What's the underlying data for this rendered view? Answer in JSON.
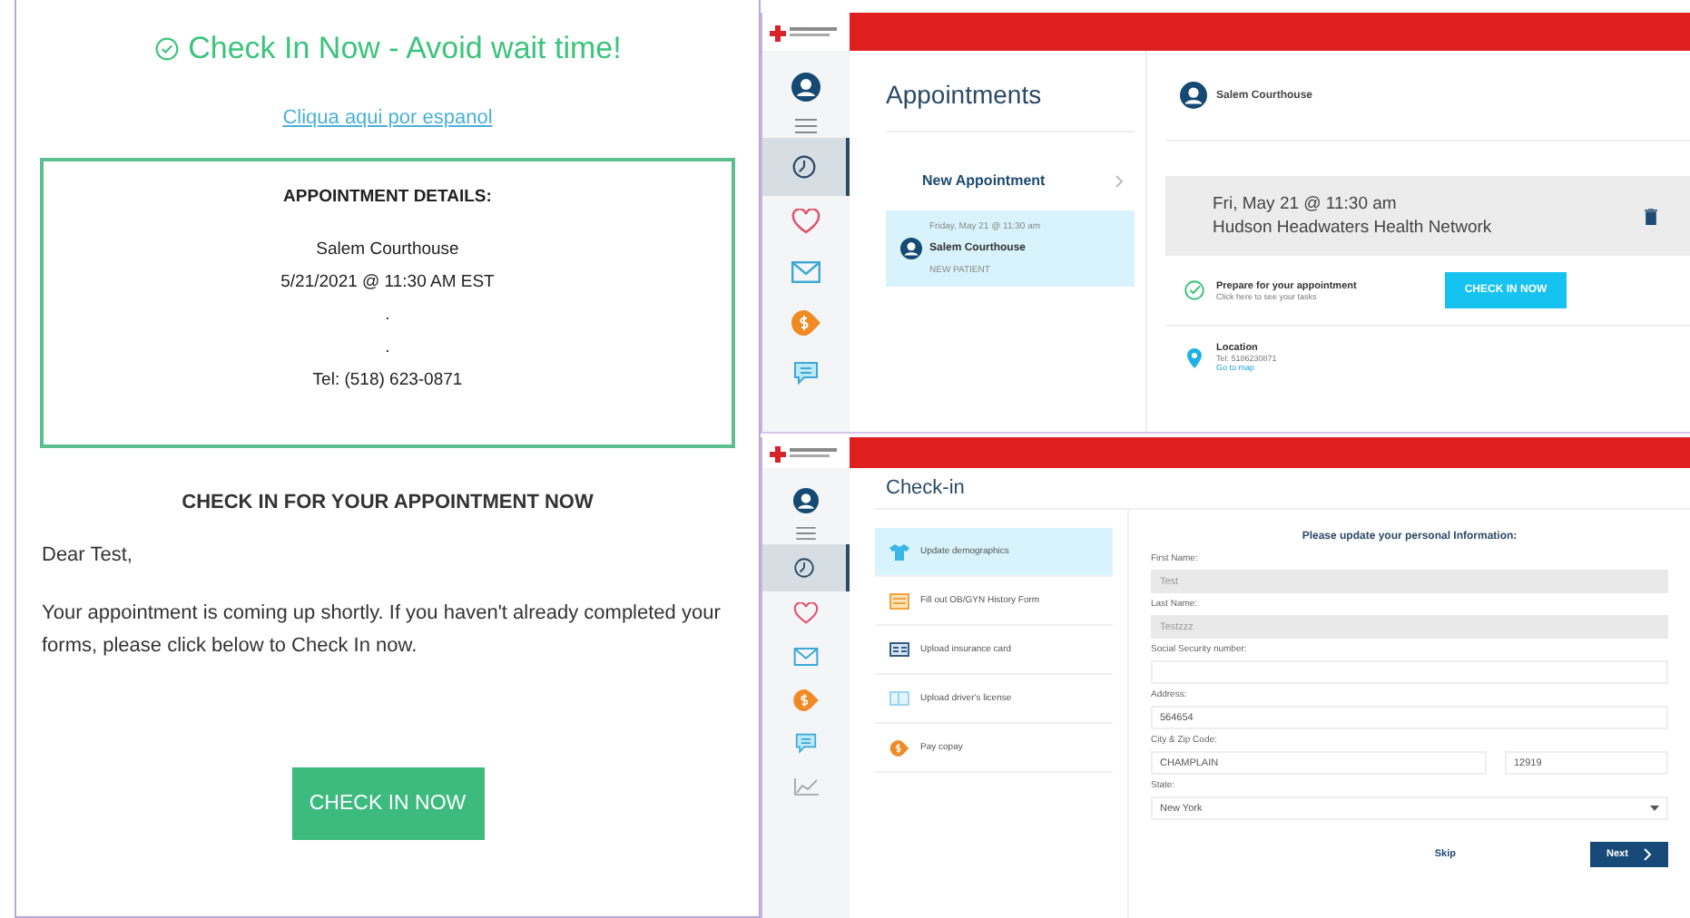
{
  "email": {
    "title": "Check In Now - Avoid wait time!",
    "spanish_link": "Cliqua aqui por espanol",
    "details": {
      "heading": "APPOINTMENT DETAILS:",
      "lines": [
        "Salem Courthouse",
        "5/21/2021 @ 11:30 AM EST",
        ".",
        ".",
        "Tel: (518) 623-0871"
      ]
    },
    "section_heading": "CHECK IN FOR YOUR APPOINTMENT NOW",
    "greeting": "Dear Test,",
    "body": "Your appointment is coming up shortly. If you haven't already completed your forms, please click below to Check In now.",
    "button": "CHECK IN NOW"
  },
  "appointments_app": {
    "nav": [
      {
        "kind": "avatar",
        "selected": false
      },
      {
        "kind": "menu",
        "selected": false
      },
      {
        "kind": "clock",
        "selected": true
      },
      {
        "kind": "heart",
        "selected": false
      },
      {
        "kind": "mail",
        "selected": false
      },
      {
        "kind": "dollar",
        "selected": false
      },
      {
        "kind": "chat",
        "selected": false
      }
    ],
    "title": "Appointments",
    "new_appointment": "New Appointment",
    "list": [
      {
        "date": "Friday, May 21 @ 11:30 am",
        "name": "Salem Courthouse",
        "tag": "NEW PATIENT",
        "selected": true
      }
    ],
    "detail": {
      "name": "Salem Courthouse",
      "date": "Fri, May 21 @ 11:30 am",
      "network": "Hudson Headwaters Health Network",
      "prepare_title": "Prepare for your appointment",
      "prepare_sub": "Click here to see your tasks",
      "button": "CHECK IN NOW",
      "location_title": "Location",
      "tel": "Tel: 5186230871",
      "map_link": "Go to map"
    }
  },
  "checkin_app": {
    "nav": [
      {
        "kind": "avatar",
        "selected": false
      },
      {
        "kind": "menu",
        "selected": false
      },
      {
        "kind": "clock",
        "selected": true
      },
      {
        "kind": "heart",
        "selected": false
      },
      {
        "kind": "mail",
        "selected": false
      },
      {
        "kind": "dollar",
        "selected": false
      },
      {
        "kind": "chat",
        "selected": false
      },
      {
        "kind": "chart",
        "selected": false
      }
    ],
    "title": "Check-in",
    "tasks": [
      {
        "kind": "shirt",
        "label": "Update demographics",
        "selected": true
      },
      {
        "kind": "form",
        "label": "Fill out OB/GYN History Form",
        "selected": false
      },
      {
        "kind": "card",
        "label": "Upload insurance card",
        "selected": false
      },
      {
        "kind": "license",
        "label": "Upload driver's license",
        "selected": false
      },
      {
        "kind": "dollar",
        "label": "Pay copay",
        "selected": false
      }
    ],
    "form": {
      "heading": "Please update your personal Information:",
      "fields": [
        {
          "label": "First Name:",
          "values": [
            "Test"
          ],
          "disabled": true,
          "kind": "text"
        },
        {
          "label": "Last Name:",
          "values": [
            "Testzzz"
          ],
          "disabled": true,
          "kind": "text"
        },
        {
          "label": "Social Security number:",
          "disabled": false,
          "kind": "text"
        },
        {
          "label": "Address:",
          "values": [
            "564654"
          ],
          "disabled": false,
          "kind": "text"
        },
        {
          "label": "City & Zip Code:",
          "values": [
            "CHAMPLAIN",
            "12919"
          ],
          "disabled": false,
          "kind": "text"
        },
        {
          "label": "State:",
          "values": [
            "New York"
          ],
          "disabled": false,
          "kind": "select"
        }
      ],
      "skip": "Skip",
      "next": "Next"
    }
  }
}
